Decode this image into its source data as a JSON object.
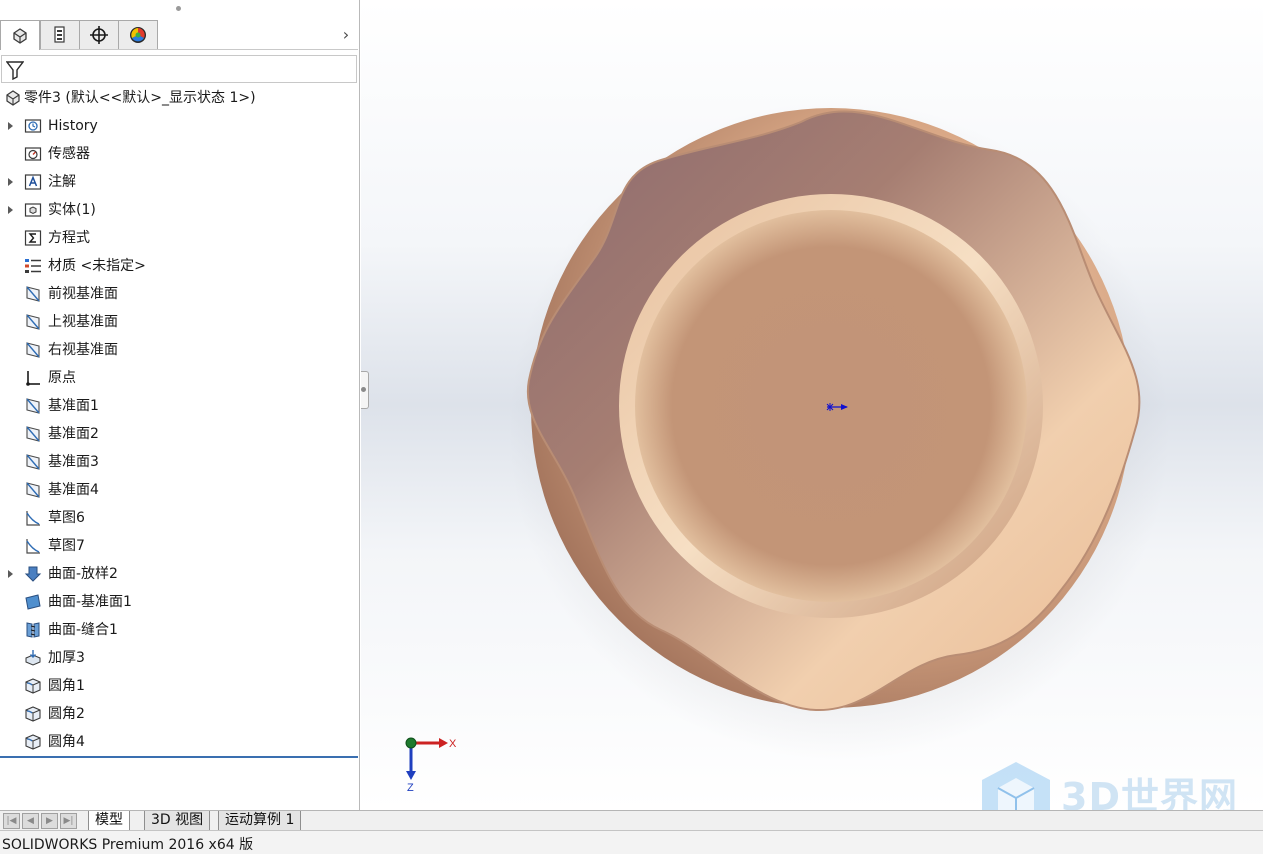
{
  "feature_tree": {
    "root": {
      "label": "零件3 (默认<<默认>_显示状态 1>)",
      "icon": "part-icon"
    },
    "items": [
      {
        "label": "History",
        "icon": "history-icon",
        "expandable": true
      },
      {
        "label": "传感器",
        "icon": "sensor-icon",
        "expandable": false
      },
      {
        "label": "注解",
        "icon": "annotation-icon",
        "expandable": true
      },
      {
        "label": "实体(1)",
        "icon": "solid-bodies-icon",
        "expandable": true
      },
      {
        "label": "方程式",
        "icon": "equations-icon",
        "expandable": false
      },
      {
        "label": "材质 <未指定>",
        "icon": "material-icon",
        "expandable": false
      },
      {
        "label": "前视基准面",
        "icon": "plane-icon",
        "expandable": false
      },
      {
        "label": "上视基准面",
        "icon": "plane-icon",
        "expandable": false
      },
      {
        "label": "右视基准面",
        "icon": "plane-icon",
        "expandable": false
      },
      {
        "label": "原点",
        "icon": "origin-icon",
        "expandable": false
      },
      {
        "label": "基准面1",
        "icon": "plane-icon",
        "expandable": false
      },
      {
        "label": "基准面2",
        "icon": "plane-icon",
        "expandable": false
      },
      {
        "label": "基准面3",
        "icon": "plane-icon",
        "expandable": false
      },
      {
        "label": "基准面4",
        "icon": "plane-icon",
        "expandable": false
      },
      {
        "label": "草图6",
        "icon": "sketch-icon",
        "expandable": false
      },
      {
        "label": "草图7",
        "icon": "sketch-icon",
        "expandable": false
      },
      {
        "label": "曲面-放样2",
        "icon": "surface-loft-icon",
        "expandable": true
      },
      {
        "label": "曲面-基准面1",
        "icon": "planar-surface-icon",
        "expandable": false
      },
      {
        "label": "曲面-缝合1",
        "icon": "knit-surface-icon",
        "expandable": false
      },
      {
        "label": "加厚3",
        "icon": "thicken-icon",
        "expandable": false
      },
      {
        "label": "圆角1",
        "icon": "fillet-icon",
        "expandable": false
      },
      {
        "label": "圆角2",
        "icon": "fillet-icon",
        "expandable": false
      },
      {
        "label": "圆角4",
        "icon": "fillet-icon",
        "expandable": false
      }
    ]
  },
  "manager_tabs": [
    {
      "name": "feature-manager-tab",
      "icon": "feature-manager-icon",
      "active": true
    },
    {
      "name": "property-manager-tab",
      "icon": "property-manager-icon",
      "active": false
    },
    {
      "name": "configuration-manager-tab",
      "icon": "configuration-manager-icon",
      "active": false
    },
    {
      "name": "display-manager-tab",
      "icon": "display-manager-icon",
      "active": false
    }
  ],
  "bottom_tabs": {
    "model": "模型",
    "view3d": "3D 视图",
    "motion": "运动算例 1"
  },
  "status_bar": {
    "text": "SOLIDWORKS Premium 2016 x64 版"
  },
  "triad": {
    "x_label": "X",
    "z_label": "Z"
  },
  "colors": {
    "model_base": "#c8987a",
    "model_inner": "#c09276",
    "axis_x": "#cc2222",
    "axis_z": "#1f3fbf",
    "origin_marker": "#1010d0",
    "tree_end_line": "#3a6fb0"
  }
}
